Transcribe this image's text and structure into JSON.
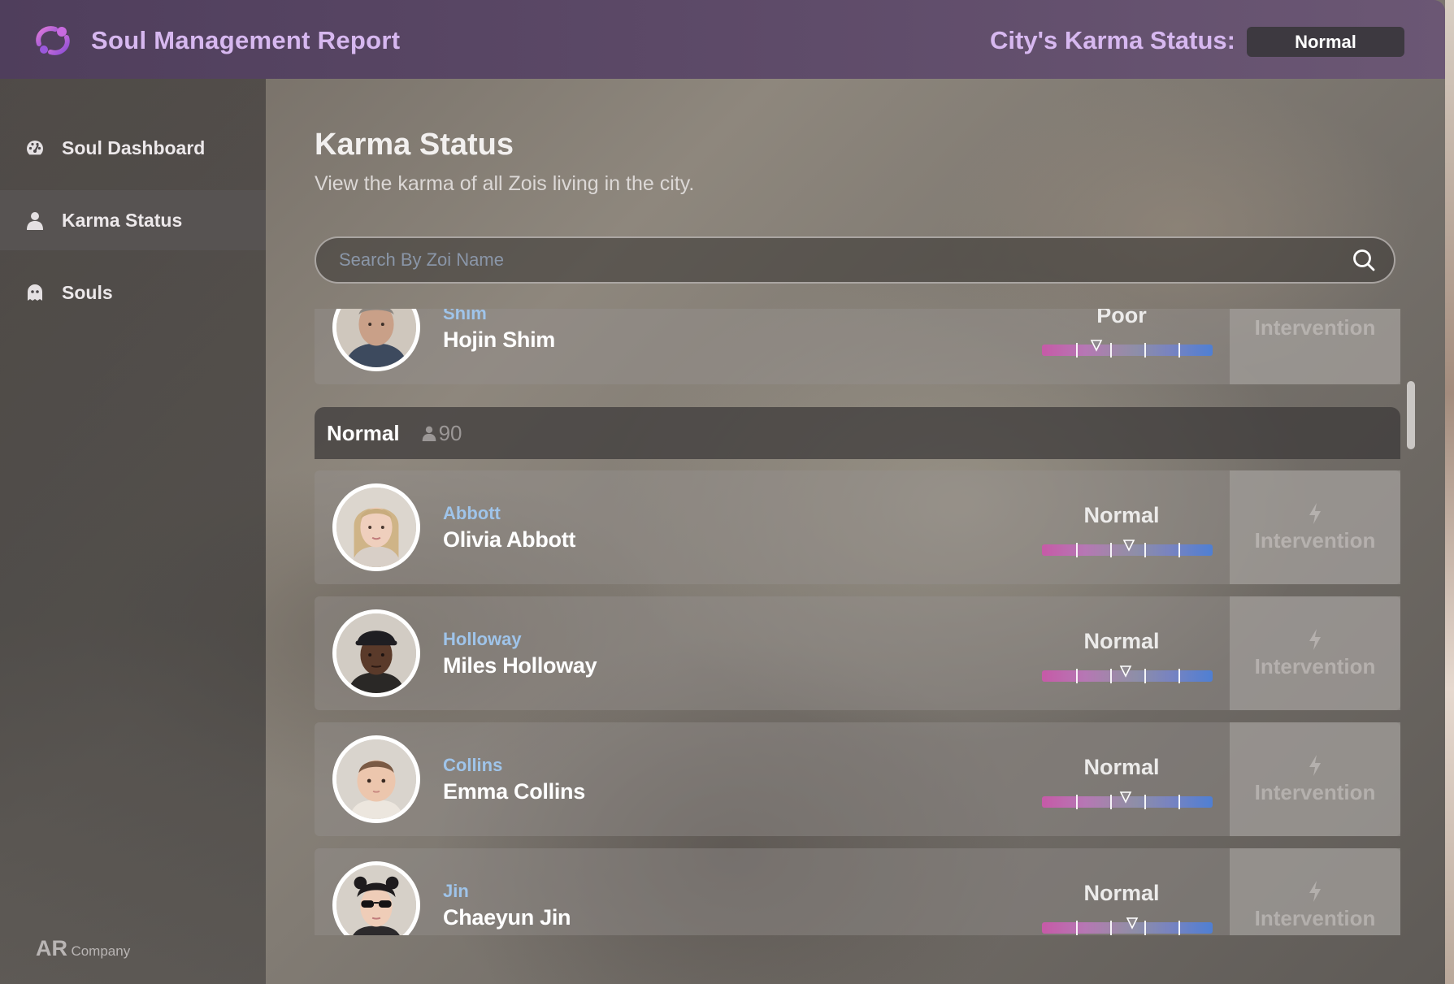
{
  "header": {
    "app_title": "Soul Management Report",
    "karma_label": "City's Karma Status:",
    "karma_value": "Normal"
  },
  "sidebar": {
    "items": [
      {
        "label": "Soul Dashboard",
        "icon": "gauge-icon"
      },
      {
        "label": "Karma Status",
        "icon": "person-icon",
        "active": true
      },
      {
        "label": "Souls",
        "icon": "ghost-icon"
      }
    ],
    "footer_brand_big": "AR",
    "footer_brand_small": "Company"
  },
  "main": {
    "title": "Karma Status",
    "subtitle": "View the karma of all Zois living in the city.",
    "search_placeholder": "Search By Zoi Name"
  },
  "colors": {
    "accent": "#d7b8f0",
    "surname": "#9fc4ea",
    "karma_bar_low": "#c65aa7",
    "karma_bar_high": "#4f7fd3"
  },
  "partial_row": {
    "surname": "Shim",
    "full_name": "Hojin Shim",
    "status": "Poor",
    "karma_level": 0.32,
    "action_label": "Intervention"
  },
  "group": {
    "name": "Normal",
    "count": "90"
  },
  "rows": [
    {
      "surname": "Abbott",
      "full_name": "Olivia Abbott",
      "status": "Normal",
      "karma_level": 0.51,
      "action_label": "Intervention",
      "avatar": "blonde-woman"
    },
    {
      "surname": "Holloway",
      "full_name": "Miles Holloway",
      "status": "Normal",
      "karma_level": 0.49,
      "action_label": "Intervention",
      "avatar": "man-cap"
    },
    {
      "surname": "Collins",
      "full_name": "Emma Collins",
      "status": "Normal",
      "karma_level": 0.49,
      "action_label": "Intervention",
      "avatar": "baby"
    },
    {
      "surname": "Jin",
      "full_name": "Chaeyun Jin",
      "status": "Normal",
      "karma_level": 0.53,
      "action_label": "Intervention",
      "avatar": "woman-sunglasses"
    }
  ]
}
